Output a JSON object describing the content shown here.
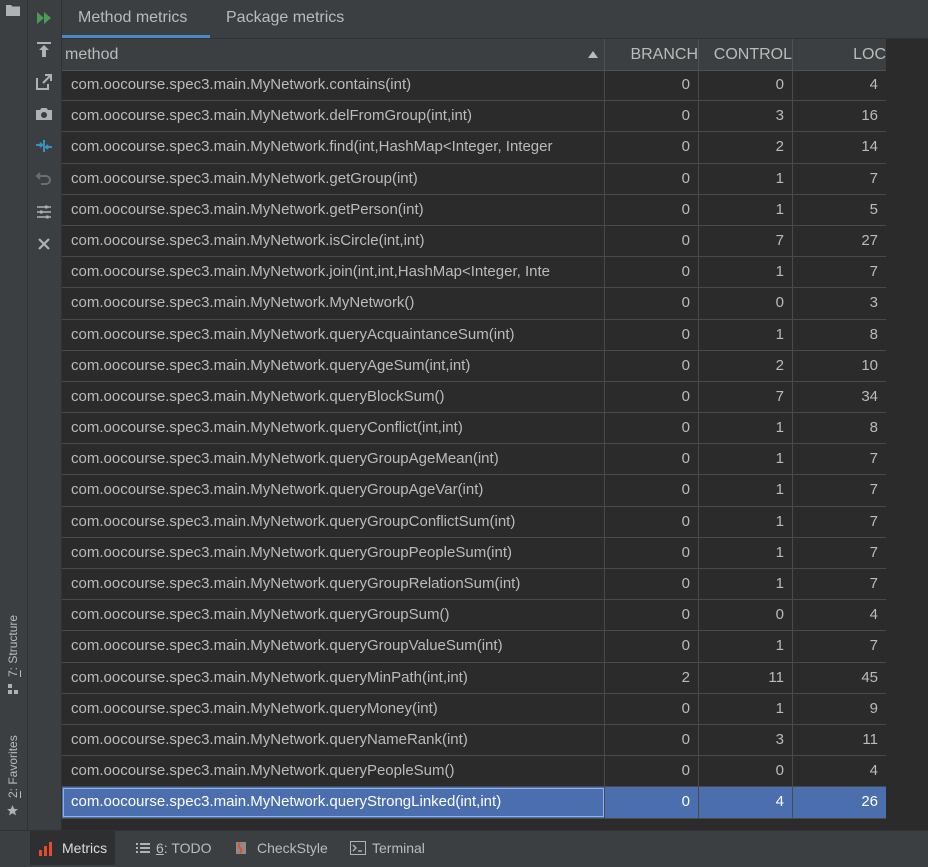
{
  "left_strip": {
    "structure_tab": {
      "number": "7",
      "label": ": Structure"
    },
    "favorites_tab": {
      "number": "2",
      "label": ": Favorites"
    }
  },
  "toolbar": {
    "icons": [
      "run-icon",
      "export-icon",
      "open-in-new-icon",
      "snapshot-icon",
      "compare-icon",
      "undo-icon",
      "settings-icon",
      "close-icon"
    ]
  },
  "tabs": [
    {
      "label": "Method metrics",
      "active": true
    },
    {
      "label": "Package metrics",
      "active": false
    }
  ],
  "table": {
    "columns": [
      "method",
      "BRANCH",
      "CONTROL",
      "LOC"
    ],
    "rows": [
      {
        "method": "com.oocourse.spec3.main.MyNetwork.contains(int)",
        "branch": "0",
        "control": "0",
        "loc": "4"
      },
      {
        "method": "com.oocourse.spec3.main.MyNetwork.delFromGroup(int,int)",
        "branch": "0",
        "control": "3",
        "loc": "16"
      },
      {
        "method": "com.oocourse.spec3.main.MyNetwork.find(int,HashMap<Integer, Integer",
        "branch": "0",
        "control": "2",
        "loc": "14"
      },
      {
        "method": "com.oocourse.spec3.main.MyNetwork.getGroup(int)",
        "branch": "0",
        "control": "1",
        "loc": "7"
      },
      {
        "method": "com.oocourse.spec3.main.MyNetwork.getPerson(int)",
        "branch": "0",
        "control": "1",
        "loc": "5"
      },
      {
        "method": "com.oocourse.spec3.main.MyNetwork.isCircle(int,int)",
        "branch": "0",
        "control": "7",
        "loc": "27"
      },
      {
        "method": "com.oocourse.spec3.main.MyNetwork.join(int,int,HashMap<Integer, Inte",
        "branch": "0",
        "control": "1",
        "loc": "7"
      },
      {
        "method": "com.oocourse.spec3.main.MyNetwork.MyNetwork()",
        "branch": "0",
        "control": "0",
        "loc": "3"
      },
      {
        "method": "com.oocourse.spec3.main.MyNetwork.queryAcquaintanceSum(int)",
        "branch": "0",
        "control": "1",
        "loc": "8"
      },
      {
        "method": "com.oocourse.spec3.main.MyNetwork.queryAgeSum(int,int)",
        "branch": "0",
        "control": "2",
        "loc": "10"
      },
      {
        "method": "com.oocourse.spec3.main.MyNetwork.queryBlockSum()",
        "branch": "0",
        "control": "7",
        "loc": "34"
      },
      {
        "method": "com.oocourse.spec3.main.MyNetwork.queryConflict(int,int)",
        "branch": "0",
        "control": "1",
        "loc": "8"
      },
      {
        "method": "com.oocourse.spec3.main.MyNetwork.queryGroupAgeMean(int)",
        "branch": "0",
        "control": "1",
        "loc": "7"
      },
      {
        "method": "com.oocourse.spec3.main.MyNetwork.queryGroupAgeVar(int)",
        "branch": "0",
        "control": "1",
        "loc": "7"
      },
      {
        "method": "com.oocourse.spec3.main.MyNetwork.queryGroupConflictSum(int)",
        "branch": "0",
        "control": "1",
        "loc": "7"
      },
      {
        "method": "com.oocourse.spec3.main.MyNetwork.queryGroupPeopleSum(int)",
        "branch": "0",
        "control": "1",
        "loc": "7"
      },
      {
        "method": "com.oocourse.spec3.main.MyNetwork.queryGroupRelationSum(int)",
        "branch": "0",
        "control": "1",
        "loc": "7"
      },
      {
        "method": "com.oocourse.spec3.main.MyNetwork.queryGroupSum()",
        "branch": "0",
        "control": "0",
        "loc": "4"
      },
      {
        "method": "com.oocourse.spec3.main.MyNetwork.queryGroupValueSum(int)",
        "branch": "0",
        "control": "1",
        "loc": "7"
      },
      {
        "method": "com.oocourse.spec3.main.MyNetwork.queryMinPath(int,int)",
        "branch": "2",
        "control": "11",
        "loc": "45"
      },
      {
        "method": "com.oocourse.spec3.main.MyNetwork.queryMoney(int)",
        "branch": "0",
        "control": "1",
        "loc": "9"
      },
      {
        "method": "com.oocourse.spec3.main.MyNetwork.queryNameRank(int)",
        "branch": "0",
        "control": "3",
        "loc": "11"
      },
      {
        "method": "com.oocourse.spec3.main.MyNetwork.queryPeopleSum()",
        "branch": "0",
        "control": "0",
        "loc": "4"
      },
      {
        "method": "com.oocourse.spec3.main.MyNetwork.queryStrongLinked(int,int)",
        "branch": "0",
        "control": "4",
        "loc": "26",
        "selected": true
      }
    ]
  },
  "bottom_bar": {
    "tabs": [
      {
        "label": "Metrics",
        "number": "",
        "active": true
      },
      {
        "label": ": TODO",
        "number": "6",
        "active": false
      },
      {
        "label": "CheckStyle",
        "number": "",
        "active": false
      },
      {
        "label": "Terminal",
        "number": "",
        "active": false
      }
    ]
  },
  "colors": {
    "accent": "#4a88c7",
    "selection": "#4b6eaf",
    "run_green": "#499c54",
    "compare_blue": "#3592c4",
    "metrics_red": "#e34d2e"
  }
}
